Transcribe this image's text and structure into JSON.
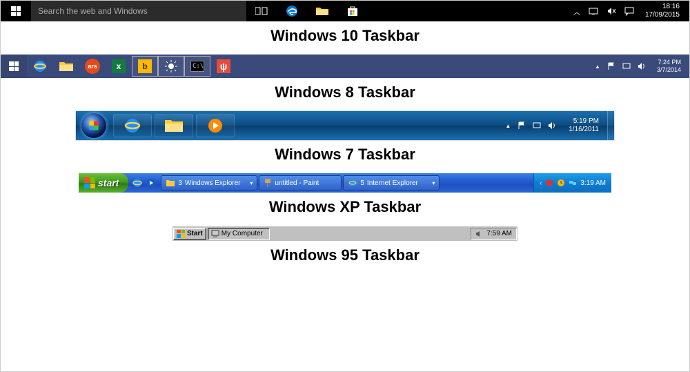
{
  "win10": {
    "search_placeholder": "Search the web and Windows",
    "time": "18:16",
    "date": "17/09/2015"
  },
  "caption10": "Windows 10 Taskbar",
  "win8": {
    "time": "7:24 PM",
    "date": "3/7/2014"
  },
  "caption8": "Windows 8 Taskbar",
  "win7": {
    "time": "5:19 PM",
    "date": "1/16/2011"
  },
  "caption7": "Windows 7 Taskbar",
  "winxp": {
    "start_label": "start",
    "task1_count": "3",
    "task1_label": "Windows Explorer",
    "task2_label": "untitled - Paint",
    "task3_count": "5",
    "task3_label": "Internet Explorer",
    "time": "3:19 AM"
  },
  "captionxp": "Windows XP Taskbar",
  "win95": {
    "start_label": "Start",
    "task1_label": "My Computer",
    "time": "7:59 AM"
  },
  "caption95": "Windows 95 Taskbar"
}
